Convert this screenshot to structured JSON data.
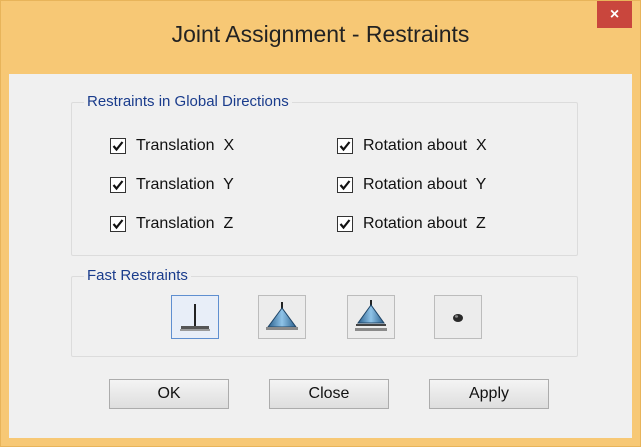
{
  "window": {
    "title": "Joint Assignment - Restraints",
    "close_glyph": "×"
  },
  "restraints_group": {
    "label": "Restraints in Global Directions",
    "items": [
      {
        "label": "Translation  X",
        "checked": true
      },
      {
        "label": "Translation  Y",
        "checked": true
      },
      {
        "label": "Translation  Z",
        "checked": true
      },
      {
        "label": "Rotation about  X",
        "checked": true
      },
      {
        "label": "Rotation about  Y",
        "checked": true
      },
      {
        "label": "Rotation about  Z",
        "checked": true
      }
    ]
  },
  "fast_restraints": {
    "label": "Fast Restraints",
    "buttons": [
      {
        "icon": "fixed-support-icon",
        "selected": true
      },
      {
        "icon": "pinned-support-icon",
        "selected": false
      },
      {
        "icon": "roller-support-icon",
        "selected": false
      },
      {
        "icon": "free-joint-icon",
        "selected": false
      }
    ]
  },
  "buttons": {
    "ok": "OK",
    "close": "Close",
    "apply": "Apply"
  },
  "colors": {
    "title_bar": "#f7c875",
    "close_button": "#c9463d",
    "group_label": "#1a3c8c",
    "dialog_bg": "#f0f0f0"
  }
}
